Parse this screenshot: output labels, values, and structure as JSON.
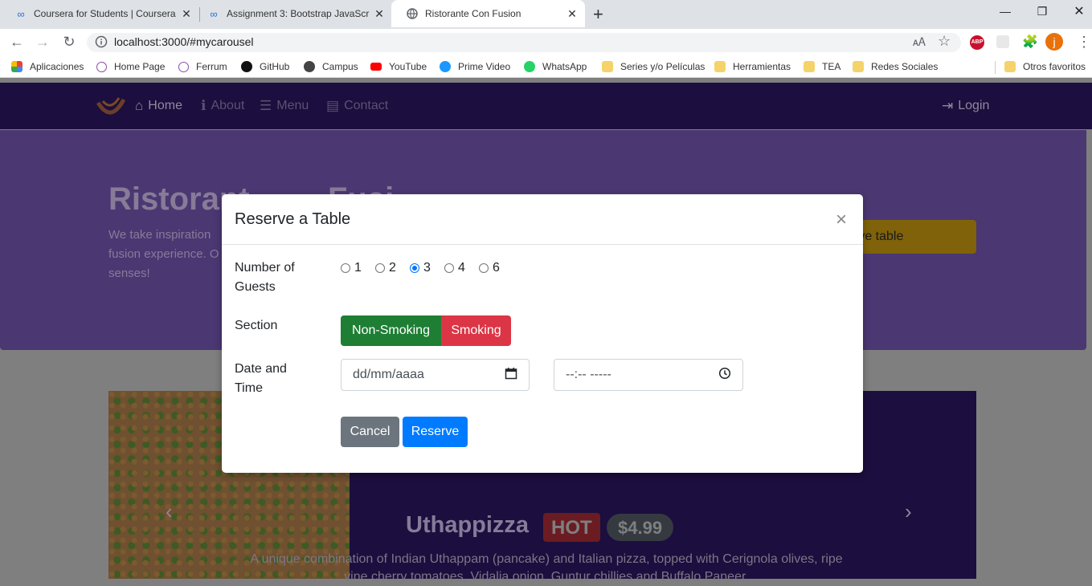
{
  "browser": {
    "tabs": [
      {
        "label": "Coursera for Students | Coursera",
        "icon": "coursera-icon"
      },
      {
        "label": "Assignment 3: Bootstrap JavaScri",
        "icon": "coursera-icon"
      },
      {
        "label": "Ristorante Con Fusion",
        "icon": "globe-icon",
        "active": true
      }
    ],
    "new_tab": "+",
    "url": "localhost:3000/#mycarousel",
    "bookmarks": [
      {
        "label": "Aplicaciones",
        "icon": "apps-grid-icon"
      },
      {
        "label": "Home Page",
        "icon": "site-icon"
      },
      {
        "label": "Ferrum",
        "icon": "site-icon"
      },
      {
        "label": "GitHub",
        "icon": "github-icon"
      },
      {
        "label": "Campus",
        "icon": "globe-icon"
      },
      {
        "label": "YouTube",
        "icon": "youtube-icon"
      },
      {
        "label": "Prime Video",
        "icon": "prime-video-icon"
      },
      {
        "label": "WhatsApp",
        "icon": "whatsapp-icon"
      },
      {
        "label": "Series y/o Películas",
        "icon": "folder-icon"
      },
      {
        "label": "Herramientas",
        "icon": "folder-icon"
      },
      {
        "label": "TEA",
        "icon": "folder-icon"
      },
      {
        "label": "Redes Sociales",
        "icon": "folder-icon"
      }
    ],
    "other_bookmarks": "Otros favoritos",
    "profile_initial": "j",
    "colors": {
      "tabbar": "#dee1e6",
      "profile": "#e8710a",
      "abp": "#c8102e"
    }
  },
  "navbar": {
    "links": [
      {
        "label": "Home",
        "icon": "home-icon"
      },
      {
        "label": "About",
        "icon": "info-icon"
      },
      {
        "label": "Menu",
        "icon": "list-icon"
      },
      {
        "label": "Contact",
        "icon": "address-card-icon"
      }
    ],
    "login": "Login",
    "colors": {
      "background": "#1c0e3e"
    }
  },
  "jumbotron": {
    "title_visible": "Ristorant",
    "title_tail": "Fusi",
    "text": "We take inspiration fusion experience. O senses!",
    "reserve_button": "rve table"
  },
  "carousel": {
    "title": "Uthappizza",
    "badge": "HOT",
    "price": "$4.99",
    "description": "A unique combination of Indian Uthappam (pancake) and Italian pizza, topped with Cerignola olives, ripe vine cherry tomatoes, Vidalia onion, Guntur chillies and Buffalo Paneer."
  },
  "modal": {
    "title": "Reserve a Table",
    "close": "×",
    "guests_label": "Number of Guests",
    "guests_options": [
      "1",
      "2",
      "3",
      "4",
      "6"
    ],
    "guests_selected": "3",
    "section_label": "Section",
    "section_options": [
      "Non-Smoking",
      "Smoking"
    ],
    "datetime_label": "Date and Time",
    "date_placeholder": "dd/mm/aaaa",
    "time_placeholder": "--:-- -----",
    "cancel": "Cancel",
    "reserve": "Reserve",
    "colors": {
      "non_smoking": "#1e7e34",
      "smoking": "#dc3545",
      "cancel": "#6c757d",
      "reserve": "#007bff"
    }
  }
}
